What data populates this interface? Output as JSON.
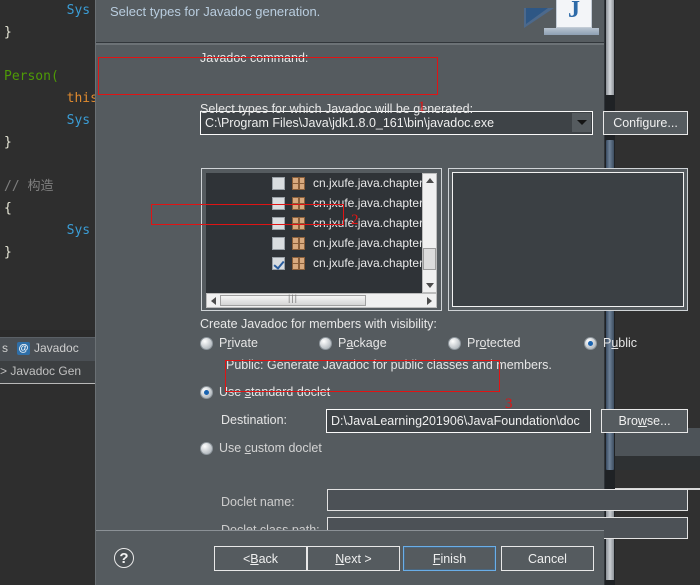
{
  "ide": {
    "code_lines": [
      {
        "indent": 2,
        "parts": [
          {
            "t": "Sys",
            "c": "c-cls"
          }
        ]
      },
      {
        "indent": 0,
        "parts": [
          {
            "t": "}",
            "c": "c-br"
          }
        ]
      },
      {
        "indent": 0,
        "parts": [
          {
            "t": "",
            "c": "c-br"
          }
        ]
      },
      {
        "indent": 0,
        "parts": [
          {
            "t": "Person(",
            "c": "c-kw"
          }
        ]
      },
      {
        "indent": 2,
        "parts": [
          {
            "t": "this",
            "c": "c-this"
          }
        ]
      },
      {
        "indent": 2,
        "parts": [
          {
            "t": "Sys",
            "c": "c-cls"
          }
        ]
      },
      {
        "indent": 0,
        "parts": [
          {
            "t": "}",
            "c": "c-br"
          }
        ]
      },
      {
        "indent": 0,
        "parts": [
          {
            "t": "",
            "c": "c-br"
          }
        ]
      },
      {
        "indent": 0,
        "parts": [
          {
            "t": "// 构造",
            "c": "c-cm"
          }
        ]
      },
      {
        "indent": 0,
        "parts": [
          {
            "t": "{",
            "c": "c-br"
          }
        ]
      },
      {
        "indent": 2,
        "parts": [
          {
            "t": "Sys",
            "c": "c-cls"
          }
        ]
      },
      {
        "indent": 0,
        "parts": [
          {
            "t": "}",
            "c": "c-br"
          }
        ]
      }
    ],
    "tab_label": "s",
    "tab_icon": "at-icon",
    "tab_name": "Javadoc",
    "breadcrumb": "> Javadoc Gen"
  },
  "dialog": {
    "title": "Select types for Javadoc generation.",
    "logo_letter": "J",
    "javadoc_command": {
      "label": "Javadoc command:",
      "value": "C:\\Program Files\\Java\\jdk1.8.0_161\\bin\\javadoc.exe",
      "dropdown_icon": "chevron-down-icon",
      "configure_label": "Configure..."
    },
    "types": {
      "label": "Select types for which Javadoc will be generated:",
      "rows": [
        {
          "label": "cn.jxufe.java.chapter",
          "checked": false
        },
        {
          "label": "cn.jxufe.java.chapter",
          "checked": false
        },
        {
          "label": "cn.jxufe.java.chapter",
          "checked": false
        },
        {
          "label": "cn.jxufe.java.chapter",
          "checked": false
        },
        {
          "label": "cn.jxufe.java.chapter",
          "checked": true
        }
      ]
    },
    "visibility": {
      "label": "Create Javadoc for members with visibility:",
      "options": [
        {
          "label": "P<u>r</u>ivate",
          "selected": false
        },
        {
          "label": "P<u>a</u>ckage",
          "selected": false
        },
        {
          "label": "Pr<u>o</u>tected",
          "selected": false
        },
        {
          "label": "P<u>u</u>blic",
          "selected": true
        }
      ],
      "description": "Public: Generate Javadoc for public classes and members."
    },
    "doclet": {
      "standard_label": "Use standard doclet",
      "standard_selected": true,
      "destination_label": "Destination:",
      "destination_value": "D:\\JavaLearning201906\\JavaFoundation\\doc",
      "browse_label": "Browse...",
      "custom_label": "Use custom doclet",
      "custom_selected": false,
      "doclet_name_label": "Doclet name:",
      "doclet_name_value": "",
      "doclet_class_path_label": "Doclet class path:",
      "doclet_class_path_value": ""
    },
    "footer": {
      "help_icon": "question-mark-icon",
      "back_label": "< Back",
      "next_label": "Next >",
      "finish_label": "Finish",
      "cancel_label": "Cancel"
    }
  },
  "annotations": {
    "color": "#e01414",
    "markers": [
      {
        "id": "1",
        "label": "1"
      },
      {
        "id": "2",
        "label": "2"
      },
      {
        "id": "3",
        "label": "3"
      }
    ]
  }
}
